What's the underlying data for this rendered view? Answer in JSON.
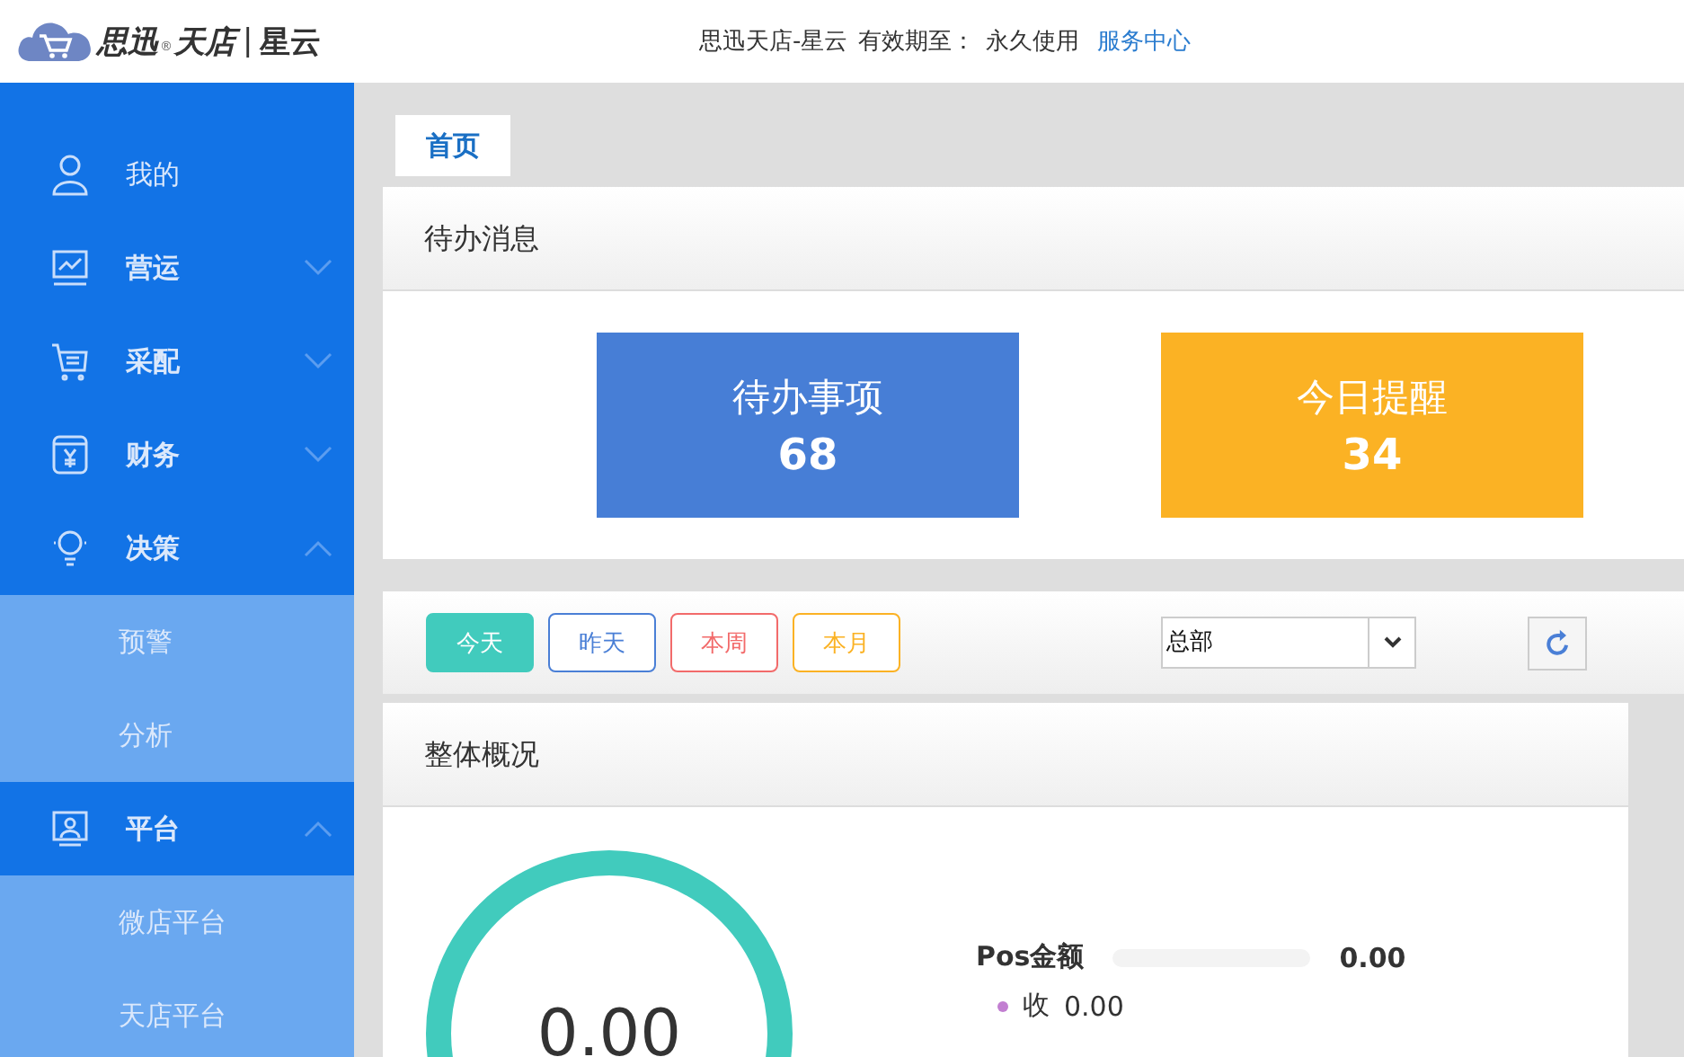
{
  "header": {
    "logo": {
      "brand": "思迅",
      "registered": "®",
      "product": "天店",
      "divider": "|",
      "edition": "星云"
    },
    "app_name": "思迅天店-星云",
    "validity_label": "有效期至：",
    "validity_value": "永久使用",
    "service_link": "服务中心"
  },
  "sidebar": {
    "items": [
      {
        "kind": "link",
        "label": "我的"
      },
      {
        "kind": "group",
        "label": "营运",
        "expanded": false
      },
      {
        "kind": "group",
        "label": "采配",
        "expanded": false
      },
      {
        "kind": "group",
        "label": "财务",
        "expanded": false
      },
      {
        "kind": "group",
        "label": "决策",
        "expanded": true,
        "children": [
          {
            "label": "预警"
          },
          {
            "label": "分析"
          }
        ]
      },
      {
        "kind": "group",
        "label": "平台",
        "expanded": true,
        "children": [
          {
            "label": "微店平台"
          },
          {
            "label": "天店平台"
          }
        ]
      }
    ]
  },
  "tabs": [
    {
      "label": "首页",
      "selected": true
    }
  ],
  "todo_panel": {
    "title": "待办消息",
    "cards": [
      {
        "label": "待办事项",
        "count": "68",
        "color": "#477ed6"
      },
      {
        "label": "今日提醒",
        "count": "34",
        "color": "#fbb224"
      }
    ]
  },
  "filters": {
    "periods": [
      {
        "label": "今天",
        "selected": true,
        "color": "#41cbbd"
      },
      {
        "label": "昨天",
        "selected": false,
        "color": "#4a7fd6"
      },
      {
        "label": "本周",
        "selected": false,
        "color": "#f26b6b"
      },
      {
        "label": "本月",
        "selected": false,
        "color": "#fbb224"
      }
    ],
    "store_select": {
      "value": "总部"
    }
  },
  "overview": {
    "title": "整体概况",
    "gauge_value": "0.00",
    "pos": {
      "label": "Pos金额",
      "level": 0,
      "amount": "0.00"
    },
    "rows": [
      {
        "label": "收",
        "value": "0.00",
        "color": "#c27fd1"
      }
    ]
  }
}
